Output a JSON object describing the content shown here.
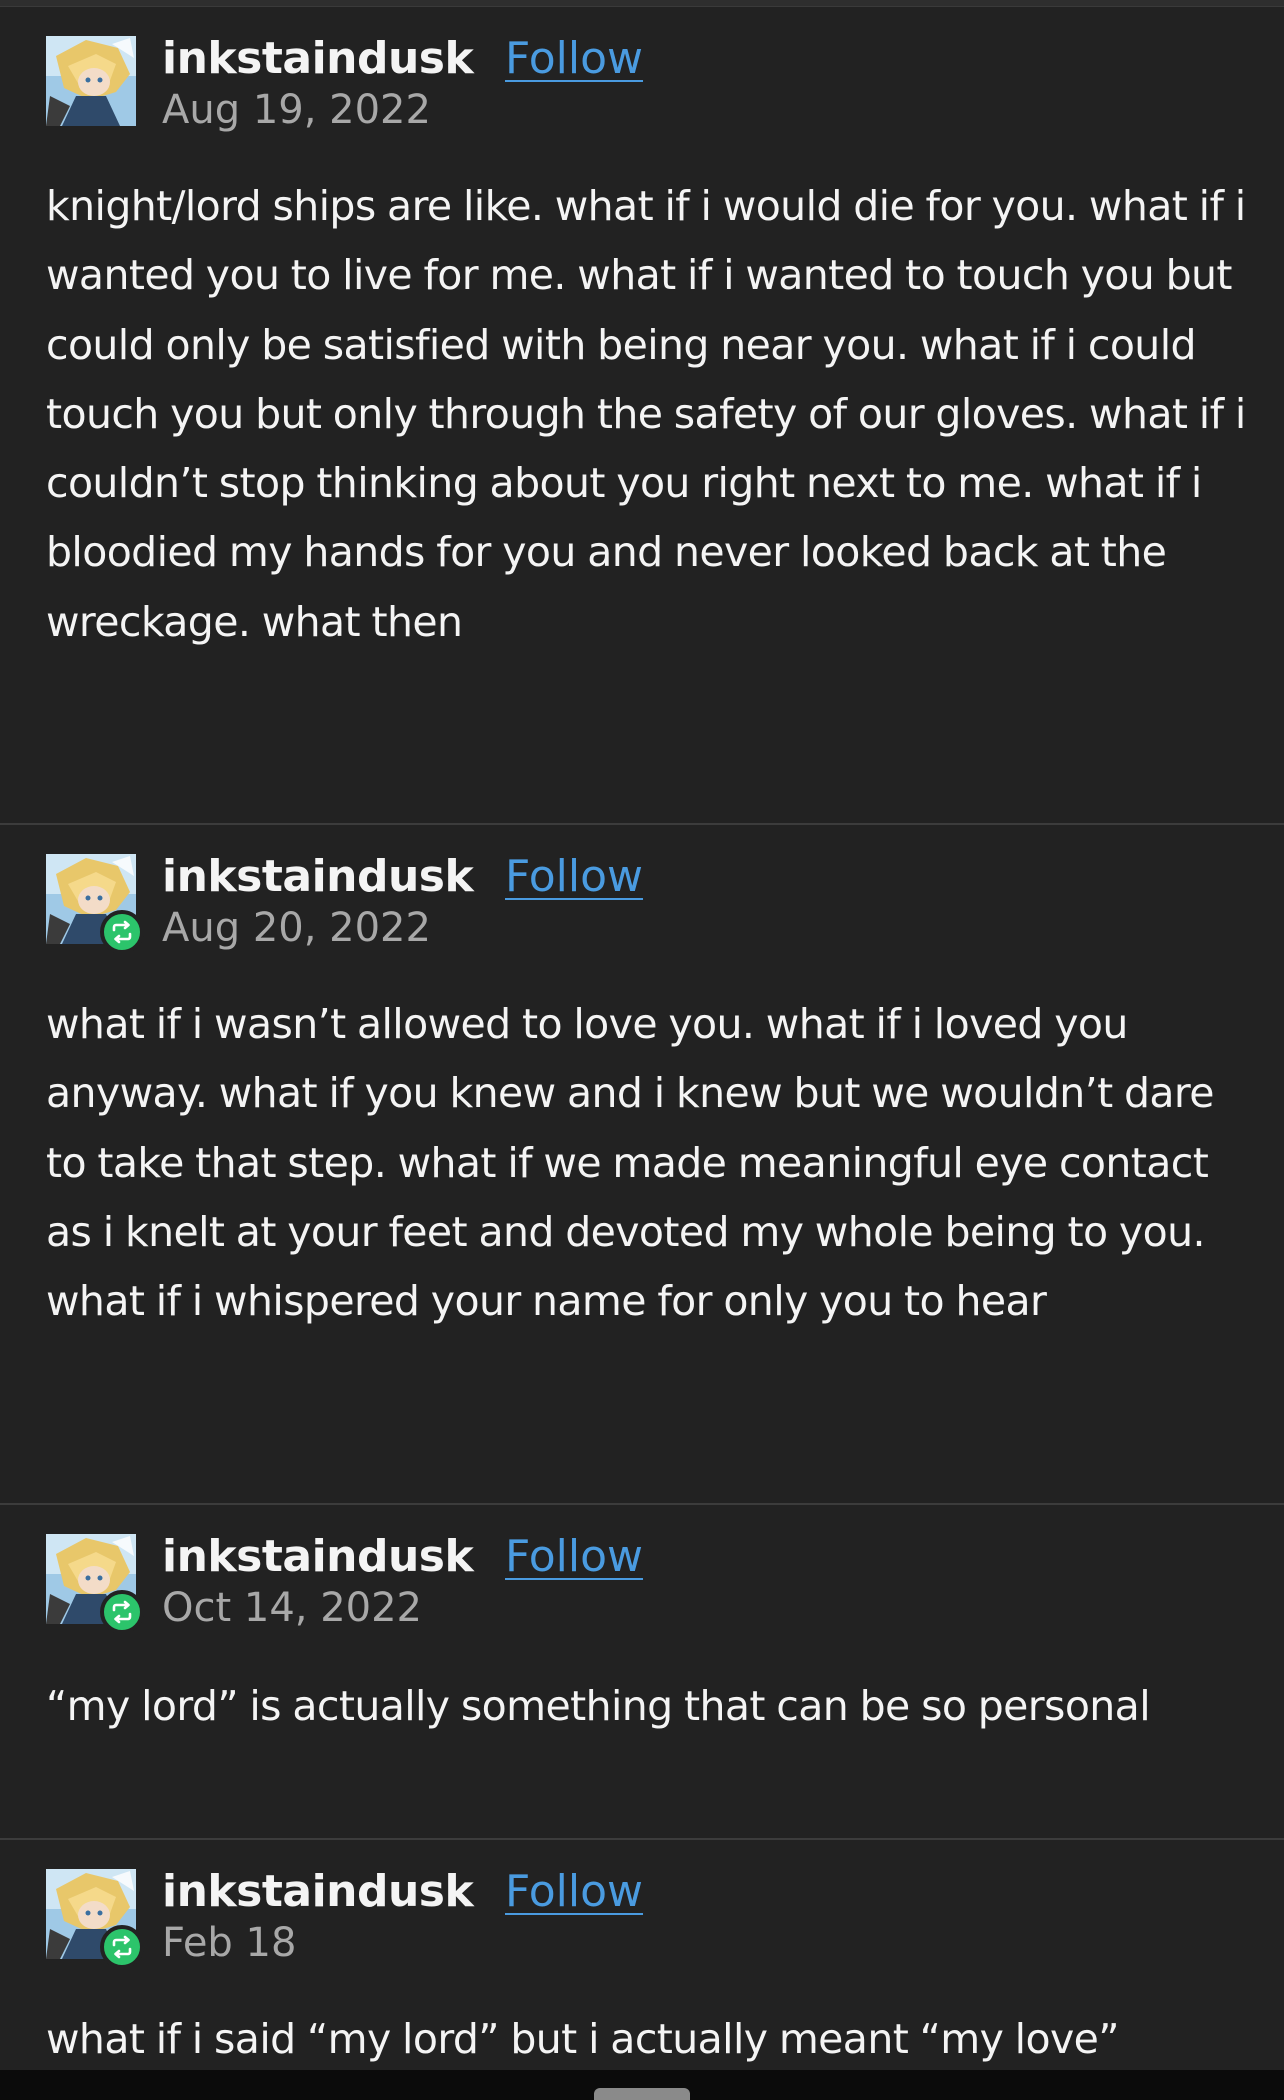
{
  "posts": [
    {
      "username": "inkstaindusk",
      "follow_label": "Follow",
      "date": "Aug 19, 2022",
      "reblog": false,
      "text": "knight/lord ships are like. what if i would die for you. what if i wanted you to live for me. what if i wanted to touch you but could only be satisfied with being near you. what if i could touch you but only through the safety of our gloves. what if i couldn’t stop thinking about you right next to me. what if i bloodied my hands for you and never looked back at the wreckage. what then"
    },
    {
      "username": "inkstaindusk",
      "follow_label": "Follow",
      "date": "Aug 20, 2022",
      "reblog": true,
      "text": "what if i wasn’t allowed to love you. what if i loved you anyway. what if you knew and i knew but we wouldn’t dare to take that step. what if we made meaningful eye contact as i knelt at your feet and devoted my whole being to you. what if i whispered your name for only you to hear"
    },
    {
      "username": "inkstaindusk",
      "follow_label": "Follow",
      "date": "Oct 14, 2022",
      "reblog": true,
      "text": "“my lord” is actually something that can be so personal"
    },
    {
      "username": "inkstaindusk",
      "follow_label": "Follow",
      "date": "Feb 18",
      "reblog": true,
      "text": "what if i said “my lord” but i actually meant “my love”"
    }
  ],
  "icons": {
    "avatar": "avatar-image",
    "reblog": "reblog-icon"
  },
  "colors": {
    "background": "#222222",
    "follow_link": "#4a9be0",
    "reblog_badge": "#2cc46b",
    "date_text": "#a8a8a8"
  }
}
